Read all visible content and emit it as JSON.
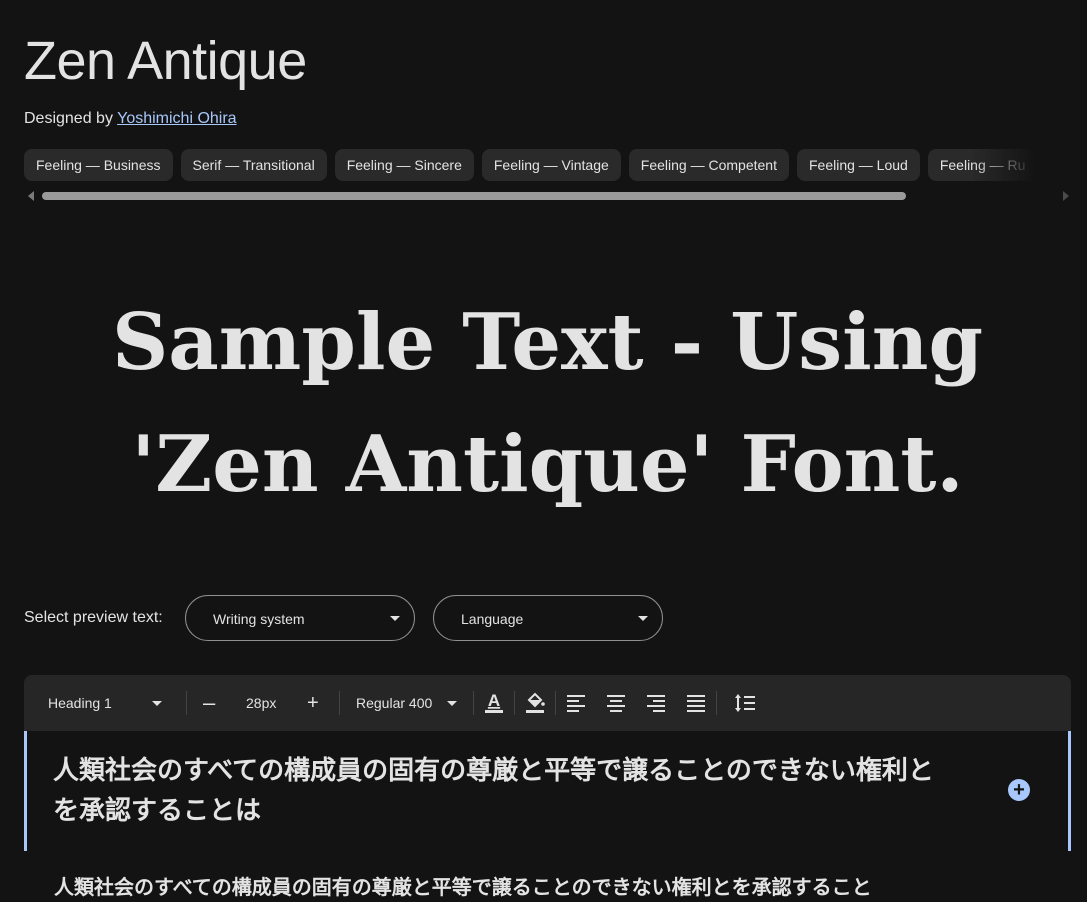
{
  "font": {
    "name": "Zen Antique",
    "designed_by_label": "Designed by",
    "designer": "Yoshimichi Ohira"
  },
  "tags": [
    "Feeling — Business",
    "Serif — Transitional",
    "Feeling — Sincere",
    "Feeling — Vintage",
    "Feeling — Competent",
    "Feeling — Loud",
    "Feeling — Ru"
  ],
  "sample_text": "Sample Text - Using 'Zen Antique' Font.",
  "preview_controls": {
    "label": "Select preview text:",
    "writing_system": "Writing system",
    "language": "Language"
  },
  "toolbar": {
    "style": "Heading 1",
    "decrease": "–",
    "size": "28px",
    "increase": "+",
    "weight": "Regular 400"
  },
  "preview": {
    "primary": "人類社会のすべての構成員の固有の尊厳と平等で譲ることのできない権利とを承認することは",
    "secondary": "人類社会のすべての構成員の固有の尊厳と平等で譲ることのできない権利とを承認すること"
  },
  "colors": {
    "background": "#131313",
    "accent": "#a8c7fa",
    "text": "#e3e3e3"
  }
}
